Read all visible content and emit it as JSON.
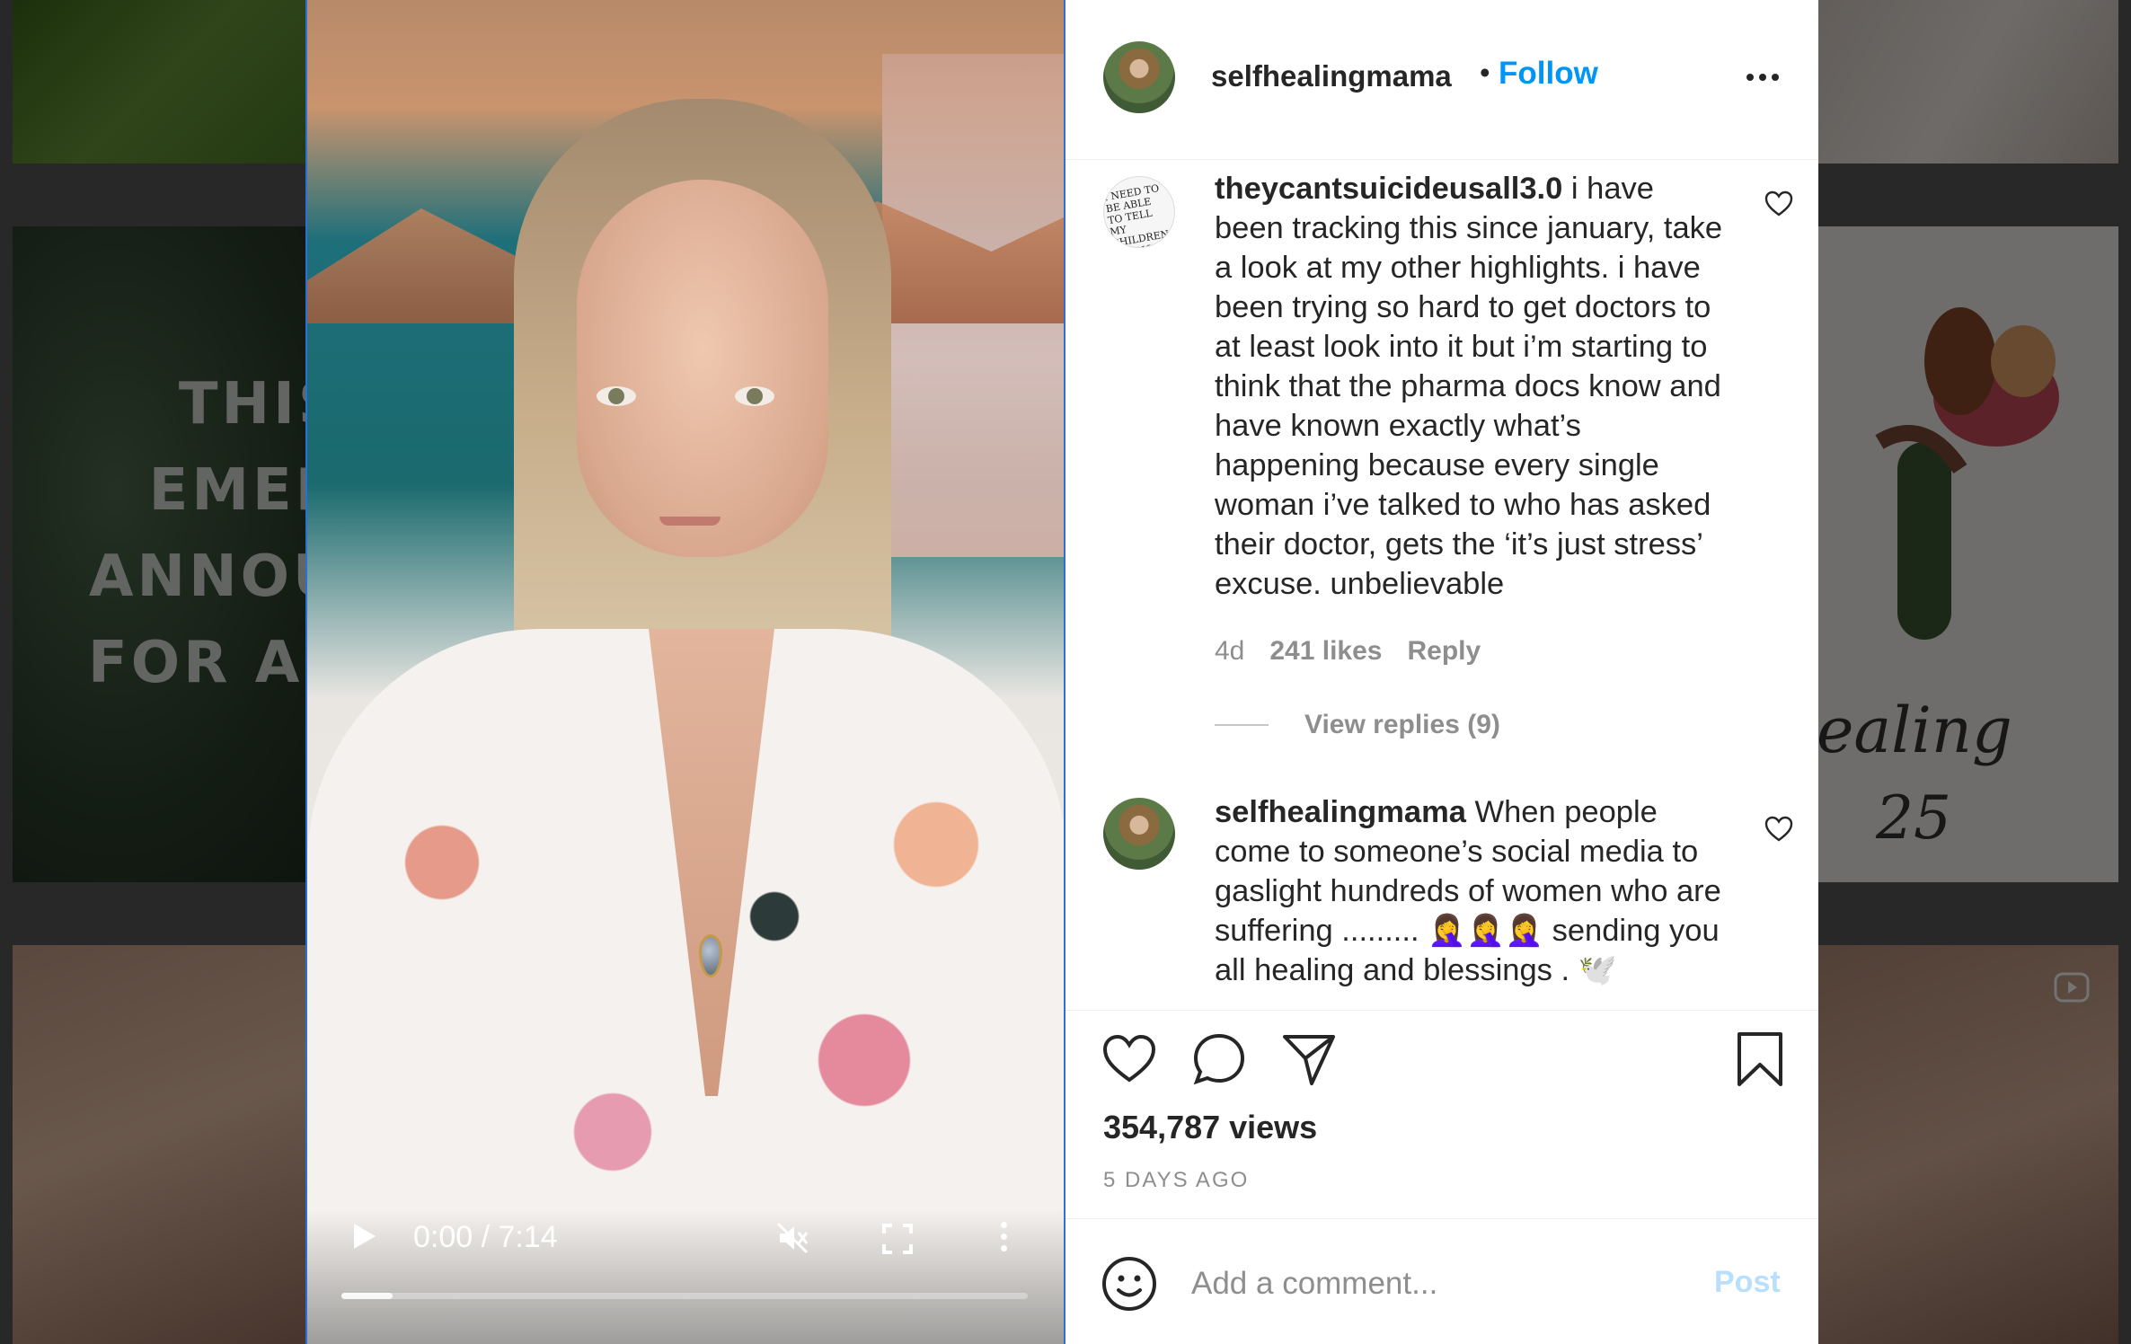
{
  "background": {
    "palm_tile_text": [
      "THIS",
      "EMER",
      "ANNOU",
      "FOR AL"
    ],
    "flower_tile_text": [
      "ealing",
      "25"
    ]
  },
  "video": {
    "time": "0:00 / 7:14",
    "progress_fraction": 0.075,
    "icons": {
      "play": "play-icon",
      "mute": "muted-speaker-icon",
      "fullscreen": "fullscreen-icon",
      "more": "vertical-dots-icon"
    }
  },
  "header": {
    "username": "selfhealingmama",
    "separator": "•",
    "follow_label": "Follow"
  },
  "comments": [
    {
      "username": "theycantsuicideusall3.0",
      "text": " i have been tracking this since january, take a look at my other highlights. i have been trying so hard to get doctors to at least look into it but i’m starting to think that the pharma docs know and have known exactly what’s happening because every single woman i’ve talked to who has asked their doctor, gets the ‘it’s just stress’ excuse. unbelievable",
      "avatar_text": "I NEED TO BE ABLE TO TELL MY CHILDREN IT'S NOT STRESS",
      "age": "4d",
      "likes": "241 likes",
      "reply_label": "Reply",
      "view_replies": "View replies (9)"
    },
    {
      "username": "selfhealingmama",
      "text": " When people come to someone’s social media to gaslight hundreds of women who are suffering ......... 🤦‍♀️🤦‍♀️🤦‍♀️ sending you all healing and blessings . 🕊️"
    }
  ],
  "actions": {
    "views": "354,787 views",
    "time_ago": "5 DAYS AGO"
  },
  "add_comment": {
    "placeholder": "Add a comment...",
    "post_label": "Post"
  },
  "colors": {
    "follow_blue": "#0095f6",
    "post_disabled": "#b9dffc",
    "text_primary": "#262626",
    "text_secondary": "#8e8e8e"
  }
}
